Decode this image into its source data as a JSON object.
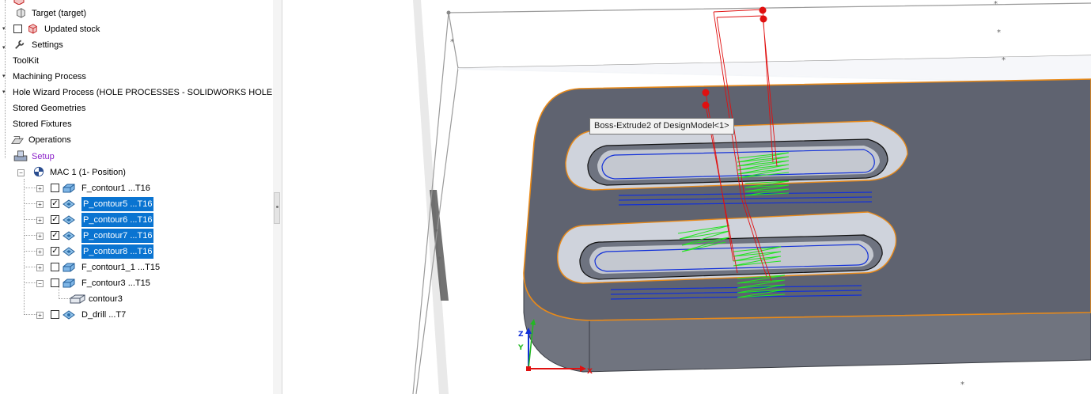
{
  "tree": {
    "items": [
      {
        "label": "Target (target)"
      },
      {
        "label": "Updated stock"
      },
      {
        "label": "Settings"
      },
      {
        "label": "ToolKit"
      },
      {
        "label": "Machining Process"
      },
      {
        "label": "Hole Wizard Process (HOLE PROCESSES - SOLIDWORKS HOLE WIZA"
      },
      {
        "label": "Stored Geometries"
      },
      {
        "label": "Stored Fixtures"
      },
      {
        "label": "Operations"
      },
      {
        "label": "Setup"
      },
      {
        "label": "MAC 1 (1- Position)"
      },
      {
        "label": "F_contour1 ...T16",
        "checked": false,
        "selected": false
      },
      {
        "label": "P_contour5 ...T16",
        "checked": true,
        "selected": true
      },
      {
        "label": "P_contour6 ...T16",
        "checked": true,
        "selected": true
      },
      {
        "label": "P_contour7 ...T16",
        "checked": true,
        "selected": true
      },
      {
        "label": "P_contour8 ...T16",
        "checked": true,
        "selected": true
      },
      {
        "label": "F_contour1_1 ...T15",
        "checked": false,
        "selected": false
      },
      {
        "label": "F_contour3 ...T15",
        "checked": false,
        "selected": false
      },
      {
        "label": "contour3"
      },
      {
        "label": "D_drill ...T7",
        "checked": false,
        "selected": false
      }
    ]
  },
  "viewport": {
    "tooltip": "Boss-Extrude2 of DesignModel<1>",
    "triad": {
      "x": "X",
      "y": "Y",
      "z": "Z"
    }
  },
  "colors": {
    "selection": "#0a74d1",
    "setup_text": "#8a1fc9",
    "part_face": "#5f6370",
    "toolpath_blue": "#1230d8",
    "toolpath_green": "#22e322",
    "toolpath_red": "#e01010",
    "edge_highlight": "#e88a1a"
  }
}
